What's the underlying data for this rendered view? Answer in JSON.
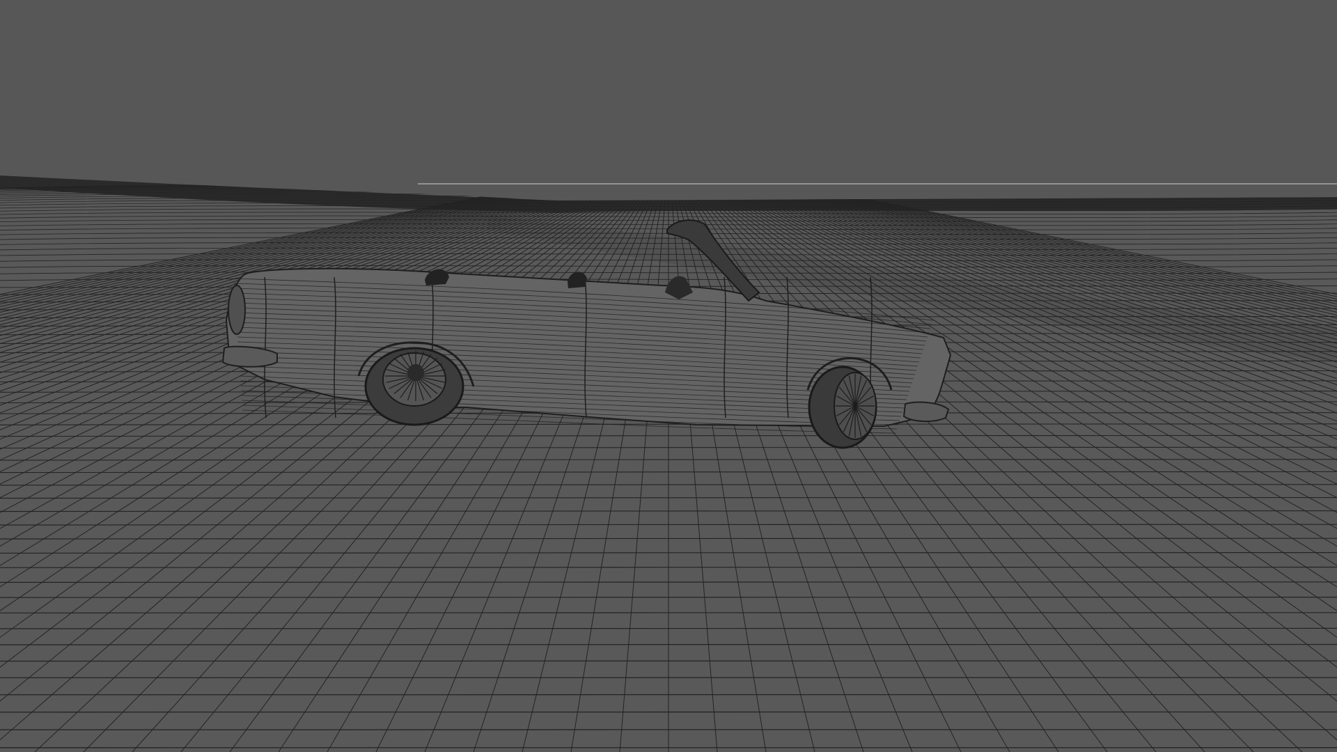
{
  "scene": {
    "colors": {
      "background": "#575757",
      "ground": "#595959",
      "wire": "#232323",
      "horizon_band": "#1f1f1f",
      "car_body": "#646464",
      "car_wire": "#1e1e1e",
      "horizon_line": "#a8a8a8"
    }
  }
}
